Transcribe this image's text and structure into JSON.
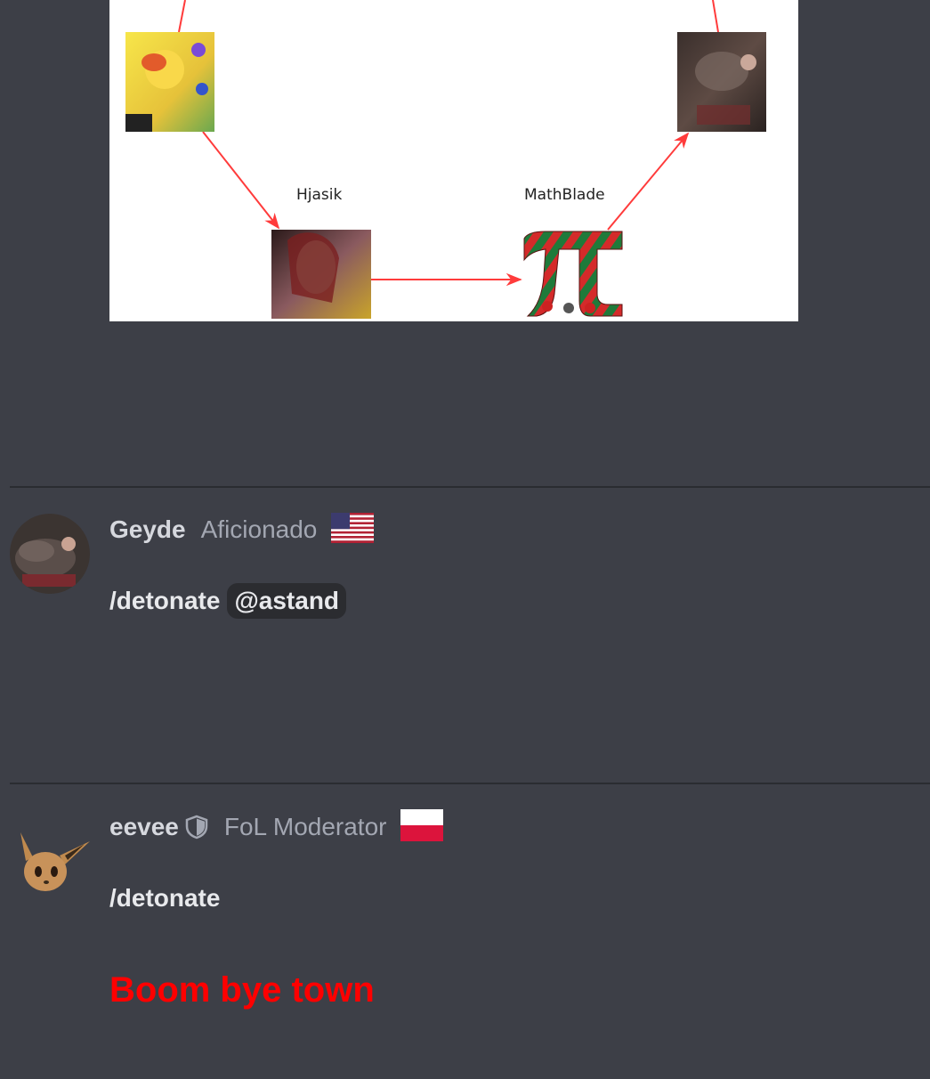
{
  "diagram": {
    "labels": [
      "Hjasik",
      "MathBlade"
    ]
  },
  "posts": [
    {
      "username": "Geyde",
      "role": "Aficionado",
      "flag": "us-flag",
      "message": "/detonate",
      "mention": "@astand"
    },
    {
      "username": "eevee",
      "role": "FoL Moderator",
      "flag": "poland-flag",
      "message": "/detonate",
      "red_text": "Boom bye town"
    }
  ],
  "colors": {
    "background": "#3d3f47",
    "username": "#d6d8de",
    "role": "#a3a7b2",
    "red_text": "#ff0000",
    "arrow": "#ff3b3b"
  }
}
